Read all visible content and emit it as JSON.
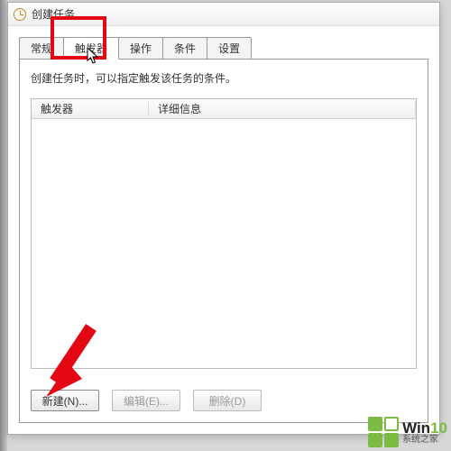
{
  "window": {
    "title": "创建任务"
  },
  "tabs": [
    {
      "label": "常规"
    },
    {
      "label": "触发器"
    },
    {
      "label": "操作"
    },
    {
      "label": "条件"
    },
    {
      "label": "设置"
    }
  ],
  "activeTabIndex": 1,
  "panel": {
    "description": "创建任务时，可以指定触发该任务的条件。"
  },
  "table": {
    "headers": {
      "trigger": "触发器",
      "details": "详细信息"
    },
    "rows": []
  },
  "buttons": {
    "new": "新建(N)...",
    "edit": "编辑(E)...",
    "delete": "删除(D)"
  },
  "watermark": {
    "brandWin": "Win",
    "brand10": "10",
    "subtitle": "系统之家"
  },
  "colors": {
    "highlight": "#e30613",
    "accent": "#7bbb44"
  }
}
